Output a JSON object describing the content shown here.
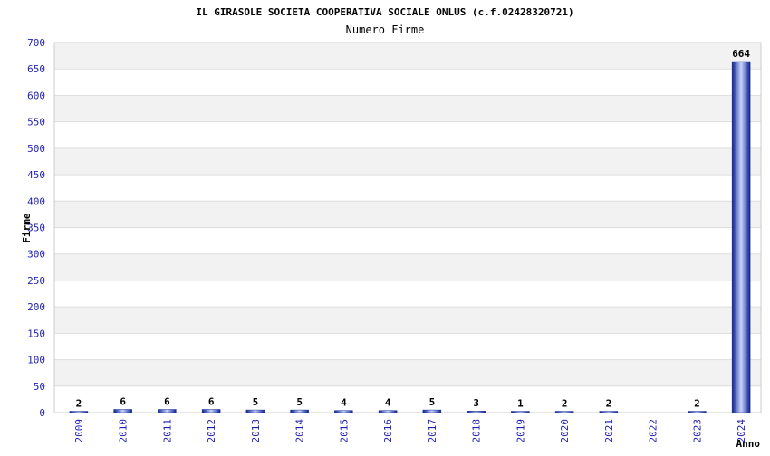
{
  "chart_data": {
    "type": "bar",
    "title": "IL GIRASOLE SOCIETA COOPERATIVA SOCIALE ONLUS (c.f.02428320721)",
    "subtitle": "Numero Firme",
    "xlabel": "Anno",
    "ylabel": "Firme",
    "categories": [
      "2009",
      "2010",
      "2011",
      "2012",
      "2013",
      "2014",
      "2015",
      "2016",
      "2017",
      "2018",
      "2019",
      "2020",
      "2021",
      "2022",
      "2023",
      "2024"
    ],
    "values": [
      2,
      6,
      6,
      6,
      5,
      5,
      4,
      4,
      5,
      3,
      1,
      2,
      2,
      null,
      2,
      664
    ],
    "ylim": [
      0,
      700
    ],
    "yticks": [
      0,
      50,
      100,
      150,
      200,
      250,
      300,
      350,
      400,
      450,
      500,
      550,
      600,
      650,
      700
    ],
    "grid": "horizontal bands",
    "colors": {
      "bar_dark": "#1a2f9a",
      "bar_light": "#c8d4ff",
      "band": "#f2f2f2",
      "grid": "#dddddd",
      "tick_label": "#1f1fb4",
      "text": "#000000"
    }
  }
}
